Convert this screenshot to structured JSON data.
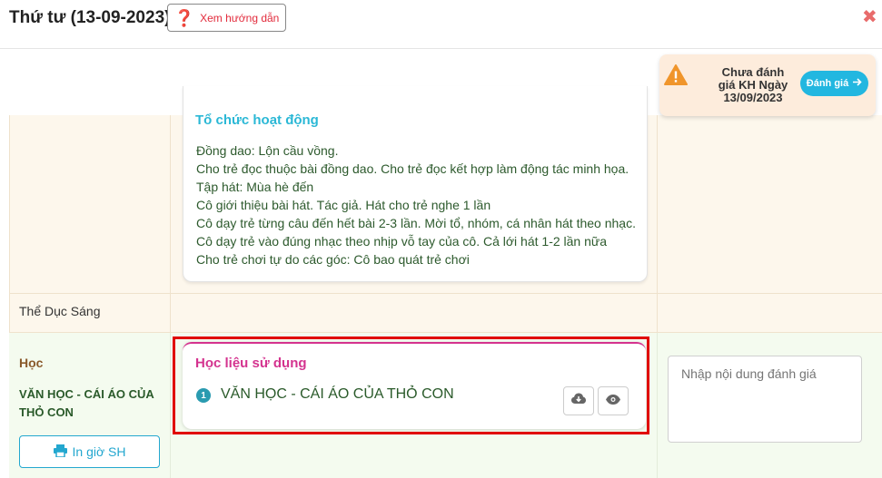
{
  "header": {
    "title": "Thứ tư (13-09-2023)",
    "help_label": "Xem hướng dẫn",
    "close_symbol": "✖"
  },
  "notice": {
    "text": "Chưa đánh giá KH Ngày 13/09/2023",
    "button_label": "Đánh giá",
    "colors": {
      "background": "#fdecdc",
      "button": "#22b7e0",
      "warning": "#f0952b"
    }
  },
  "activity": {
    "title": "Tổ chức hoạt động",
    "lines": [
      "Đồng dao: Lộn cầu vồng.",
      "Cho trẻ đọc thuộc bài đồng dao. Cho trẻ đọc kết hợp làm động tác minh họa.",
      "Tập hát: Mùa hè đến",
      "Cô giới thiệu bài hát. Tác giả. Hát cho trẻ nghe 1 lần",
      "Cô dạy trẻ từng câu đến hết bài 2-3 lần. Mời tổ, nhóm, cá nhân hát theo nhạc.",
      "Cô dạy trẻ vào đúng nhạc theo nhịp vỗ tay của cô. Cả lới hát 1-2 lần nữa",
      "Cho trẻ chơi tự do các góc: Cô bao quát trẻ chơi"
    ]
  },
  "rows": {
    "morning_exercise": "Thể Dục Sáng",
    "study": "Học",
    "lesson_name": "VĂN HỌC - CÁI ÁO CỦA THỎ CON",
    "print_label": "In giờ SH"
  },
  "materials": {
    "title": "Học liệu sử dụng",
    "items": [
      {
        "number": "1",
        "name": "VĂN HỌC - CÁI ÁO CỦA THỎ CON"
      }
    ],
    "download_icon": "cloud-download-icon",
    "view_icon": "eye-icon"
  },
  "evaluation": {
    "placeholder": "Nhập nội dung đánh giá"
  },
  "colors": {
    "accent_pink": "#d4338f",
    "accent_cyan": "#2bb8d6",
    "highlight_red": "#e00000",
    "text_green": "#2a5a2a"
  }
}
